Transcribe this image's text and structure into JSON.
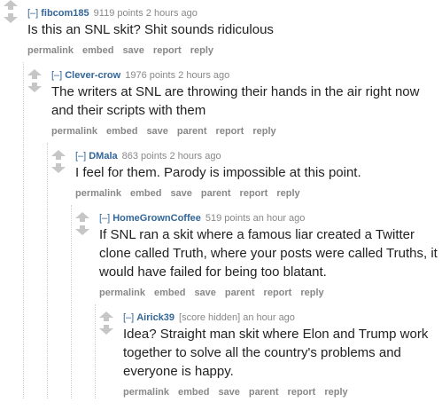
{
  "comments": [
    {
      "expand": "[–]",
      "author": "fibcom185",
      "meta": "9119 points 2 hours ago",
      "text": "Is this an SNL skit? Shit sounds ridiculous",
      "buttons": [
        "permalink",
        "embed",
        "save",
        "report",
        "reply"
      ]
    },
    {
      "expand": "[–]",
      "author": "Clever-crow",
      "meta": "1976 points 2 hours ago",
      "text": "The writers at SNL are throwing their hands in the air right now and their scripts with them",
      "buttons": [
        "permalink",
        "embed",
        "save",
        "parent",
        "report",
        "reply"
      ]
    },
    {
      "expand": "[–]",
      "author": "DMala",
      "meta": "863 points 2 hours ago",
      "text": "I feel for them. Parody is impossible at this point.",
      "buttons": [
        "permalink",
        "embed",
        "save",
        "parent",
        "report",
        "reply"
      ]
    },
    {
      "expand": "[–]",
      "author": "HomeGrownCoffee",
      "meta": "519 points an hour ago",
      "text": "If SNL ran a skit where a famous liar created a Twitter clone called Truth, where your posts were called Truths, it would have failed for being too blatant.",
      "buttons": [
        "permalink",
        "embed",
        "save",
        "parent",
        "report",
        "reply"
      ]
    },
    {
      "expand": "[–]",
      "author": "Airick39",
      "meta": "[score hidden] an hour ago",
      "text": "Idea? Straight man skit where Elon and Trump work together to solve all the country's problems and everyone is happy.",
      "buttons": [
        "permalink",
        "embed",
        "save",
        "parent",
        "report",
        "reply"
      ]
    }
  ],
  "colors": {
    "author": "#336699",
    "meta": "#888888",
    "arrow": "#c6c6c6",
    "text": "#222222"
  },
  "icons": {
    "upvote": "up-arrow-icon",
    "downvote": "down-arrow-icon"
  }
}
